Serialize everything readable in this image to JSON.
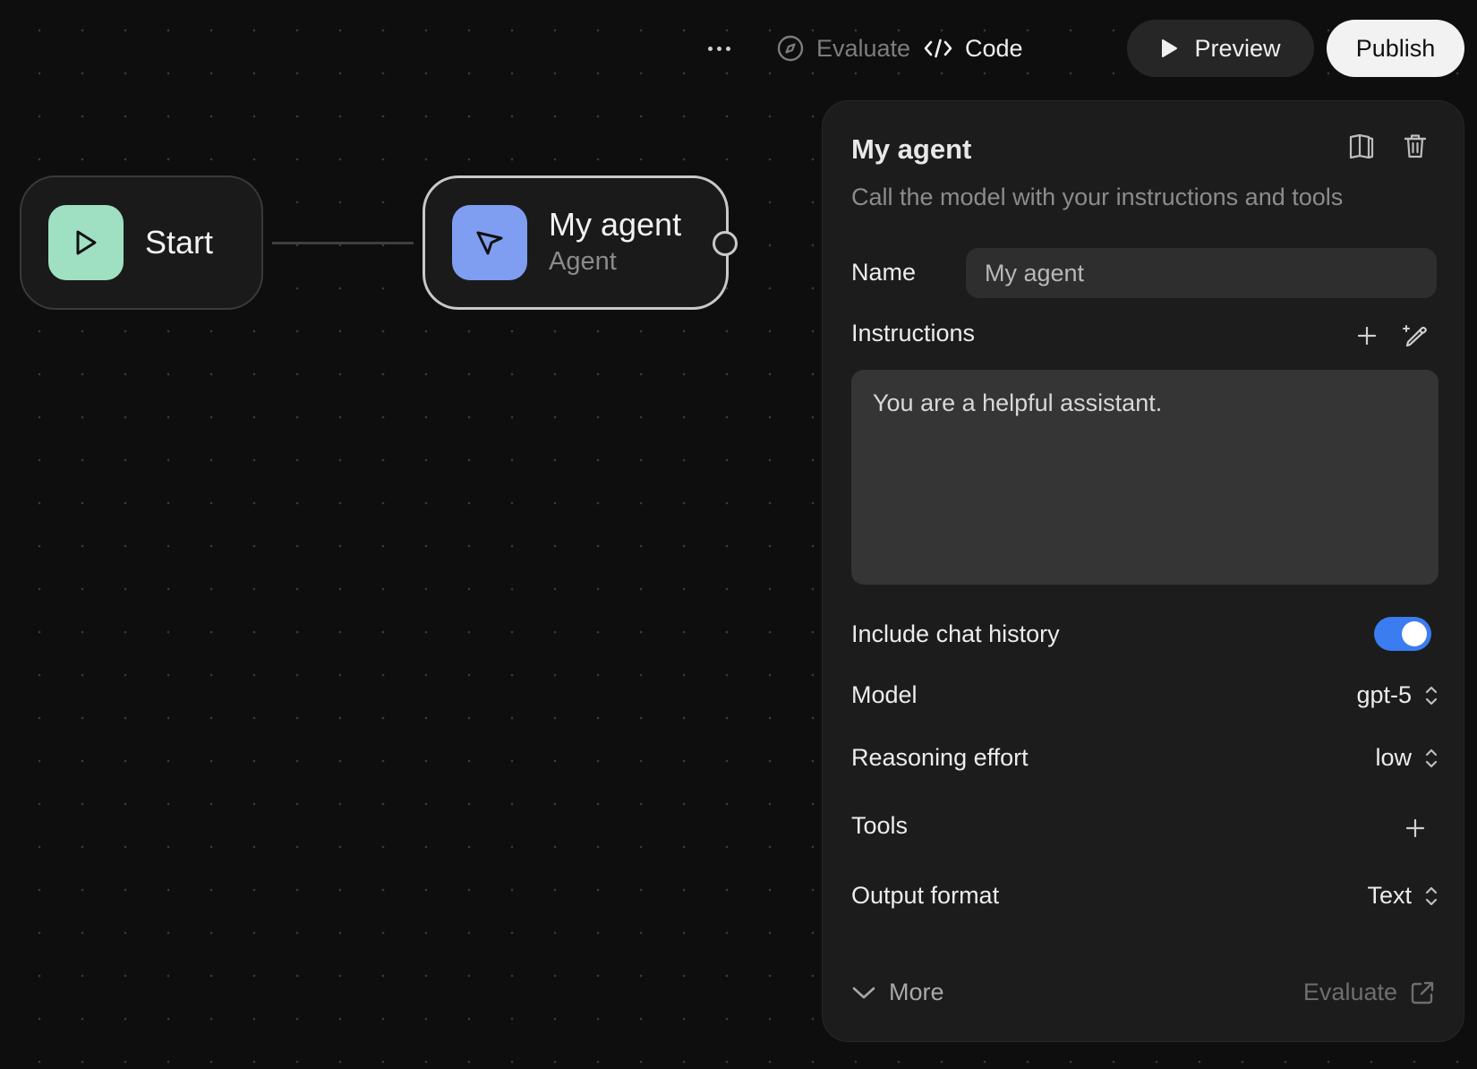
{
  "topbar": {
    "more_icon": "more-horizontal-icon",
    "evaluate_label": "Evaluate",
    "code_label": "Code",
    "preview_label": "Preview",
    "publish_label": "Publish"
  },
  "nodes": {
    "start": {
      "title": "Start",
      "icon": "play-icon",
      "color": "#9fe0c3"
    },
    "agent": {
      "title": "My agent",
      "subtitle": "Agent",
      "icon": "cursor-arrow-icon",
      "color": "#7f9ef2"
    }
  },
  "panel": {
    "title": "My agent",
    "description": "Call the model with your instructions and tools",
    "name_label": "Name",
    "name_value": "My agent",
    "instructions_label": "Instructions",
    "instructions_value": "You are a helpful assistant.",
    "chat_history_label": "Include chat history",
    "chat_history_enabled": true,
    "model_label": "Model",
    "model_value": "gpt-5",
    "reasoning_label": "Reasoning effort",
    "reasoning_value": "low",
    "tools_label": "Tools",
    "output_label": "Output format",
    "output_value": "Text",
    "more_label": "More",
    "evaluate_label": "Evaluate",
    "accent_color": "#3b7cf0"
  }
}
